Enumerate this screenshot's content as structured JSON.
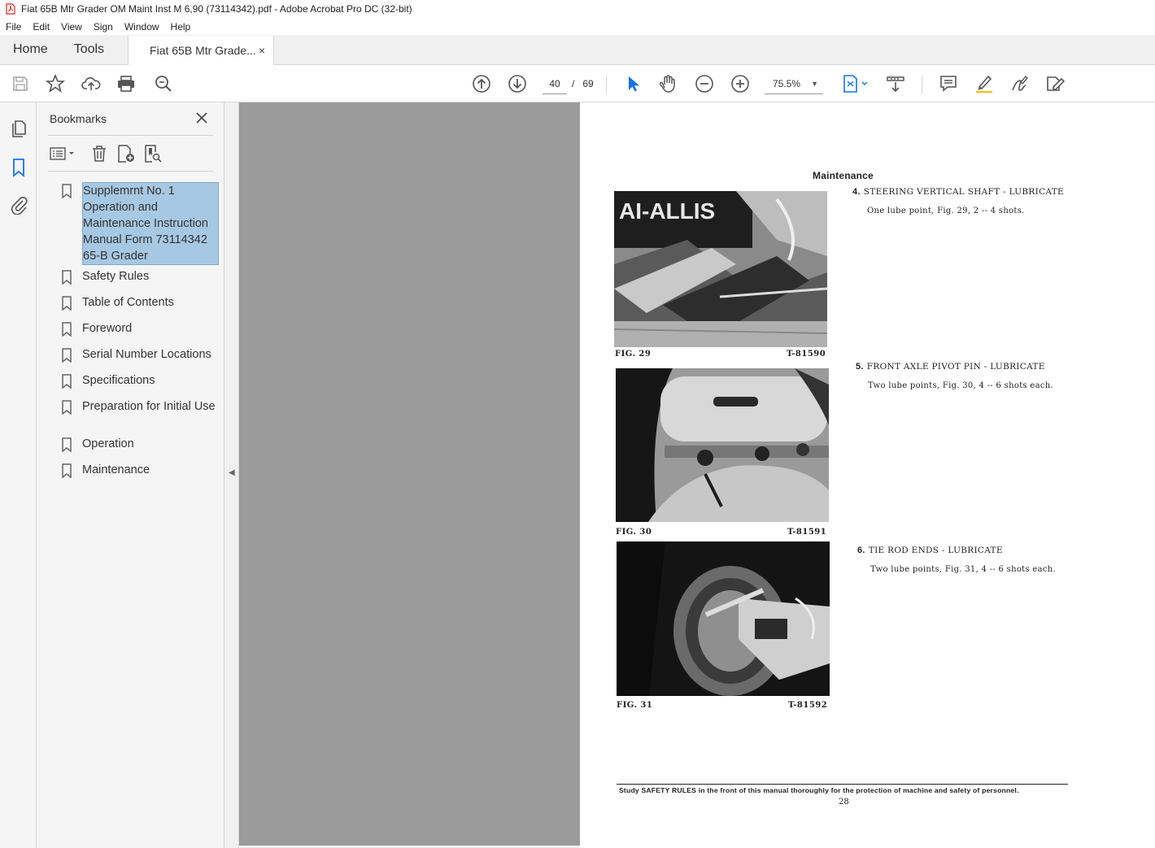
{
  "window": {
    "title": "Fiat 65B Mtr Grader OM Maint Inst M 6,90 (73114342).pdf - Adobe Acrobat Pro DC (32-bit)"
  },
  "menu": [
    "File",
    "Edit",
    "View",
    "Sign",
    "Window",
    "Help"
  ],
  "tabs": {
    "home": "Home",
    "tools": "Tools",
    "document": "Fiat 65B Mtr Grade...",
    "close": "×"
  },
  "toolbar": {
    "current_page": "40",
    "page_separator": "/",
    "total_pages": "69",
    "zoom": "75.5%",
    "icons": [
      "save-icon",
      "star-icon",
      "upload-icon",
      "print-icon",
      "zoom-search-icon",
      "prev-page-icon",
      "next-page-icon",
      "select-cursor-icon",
      "hand-icon",
      "zoom-out-icon",
      "zoom-in-icon",
      "fit-page-icon",
      "scroll-mode-icon",
      "comment-icon",
      "highlight-icon",
      "sign-icon",
      "edit-pdf-icon"
    ]
  },
  "bookmarks": {
    "header": "Bookmarks",
    "items": [
      {
        "label": "Supplemrnt No. 1 Operation and Maintenance Instruction Manual Form 73114342 65-B Grader",
        "selected": true
      },
      {
        "label": "Safety Rules"
      },
      {
        "label": "Table of Contents"
      },
      {
        "label": "Foreword"
      },
      {
        "label": "Serial Number Locations"
      },
      {
        "label": "Specifications"
      },
      {
        "label": "Preparation for Initial Use"
      },
      {
        "label": "Operation"
      },
      {
        "label": "Maintenance"
      }
    ]
  },
  "document_page": {
    "section": "Maintenance",
    "figures": [
      {
        "caption": "FIG. 29",
        "code": "T-81590"
      },
      {
        "caption": "FIG. 30",
        "code": "T-81591"
      },
      {
        "caption": "FIG. 31",
        "code": "T-81592"
      }
    ],
    "steps": [
      {
        "num": "4.",
        "title": "STEERING VERTICAL SHAFT - LUBRICATE",
        "desc": "One lube point, Fig. 29, 2 -- 4 shots."
      },
      {
        "num": "5.",
        "title": "FRONT AXLE PIVOT PIN - LUBRICATE",
        "desc": "Two lube points, Fig. 30, 4 -- 6 shots each."
      },
      {
        "num": "6.",
        "title": "TIE ROD ENDS - LUBRICATE",
        "desc": "Two lube points, Fig. 31, 4 -- 6 shots each."
      }
    ],
    "photo_text": "AI-ALLIS",
    "footer": "Study SAFETY RULES in the front of this manual thoroughly for the protection of machine and safety of personnel.",
    "page_number": "28"
  },
  "colors": {
    "selection": "#a7c8e2",
    "acrobat_red": "#d4251c",
    "accent_blue": "#1473e6",
    "viewer_gray": "#9b9b9b"
  }
}
